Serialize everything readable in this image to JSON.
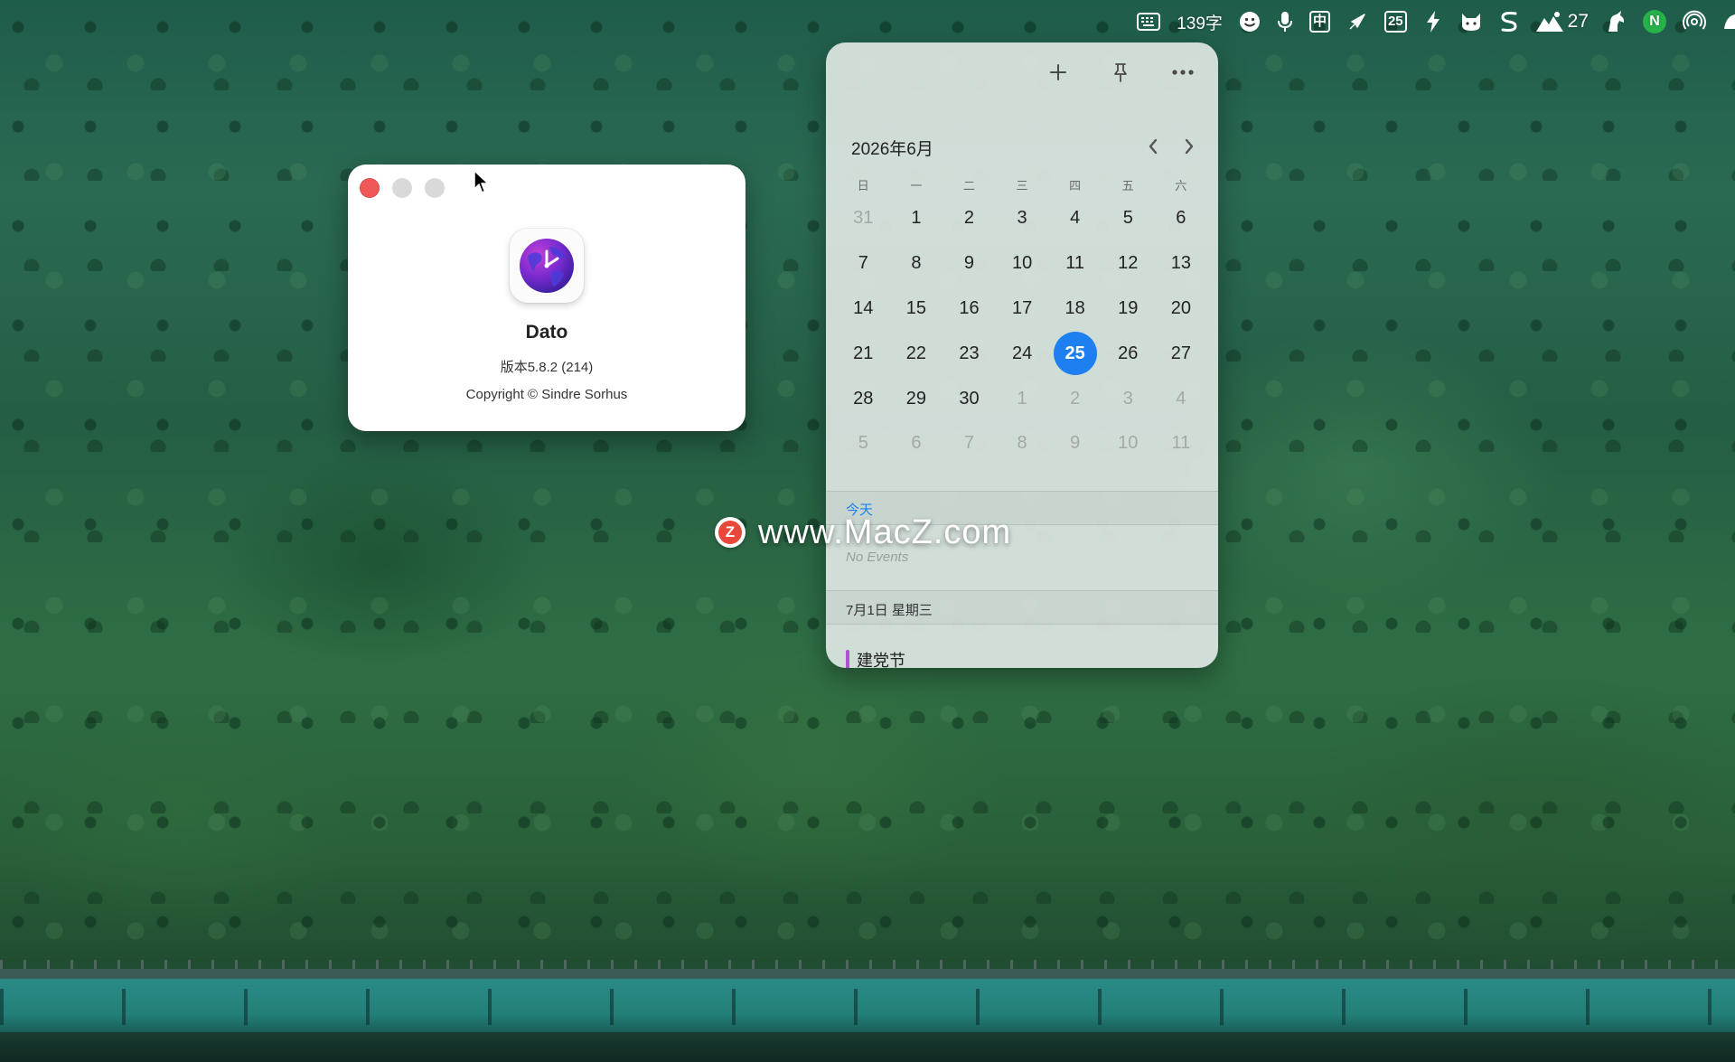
{
  "menubar": {
    "word_count": "139字",
    "ime": "中",
    "date_badge": "25",
    "weather_temp": "27",
    "notion_letter": "N",
    "icons": [
      "keyboard-icon",
      "emoji-icon",
      "microphone-icon",
      "ime-icon",
      "rocket-icon",
      "calendar-date-icon",
      "lightning-icon",
      "cat-icon",
      "scrivener-s-icon",
      "weather-icon",
      "unicorn-icon",
      "notion-icon",
      "airdrop-icon",
      "bird-icon"
    ]
  },
  "about": {
    "app_name": "Dato",
    "version": "版本5.8.2 (214)",
    "copyright": "Copyright © Sindre Sorhus"
  },
  "calendar": {
    "title": "2026年6月",
    "weekdays": [
      "日",
      "一",
      "二",
      "三",
      "四",
      "五",
      "六"
    ],
    "weeks": [
      [
        {
          "d": "31",
          "m": true
        },
        {
          "d": "1"
        },
        {
          "d": "2"
        },
        {
          "d": "3"
        },
        {
          "d": "4"
        },
        {
          "d": "5"
        },
        {
          "d": "6"
        }
      ],
      [
        {
          "d": "7"
        },
        {
          "d": "8"
        },
        {
          "d": "9"
        },
        {
          "d": "10"
        },
        {
          "d": "11"
        },
        {
          "d": "12"
        },
        {
          "d": "13"
        }
      ],
      [
        {
          "d": "14"
        },
        {
          "d": "15"
        },
        {
          "d": "16"
        },
        {
          "d": "17"
        },
        {
          "d": "18"
        },
        {
          "d": "19"
        },
        {
          "d": "20"
        }
      ],
      [
        {
          "d": "21"
        },
        {
          "d": "22"
        },
        {
          "d": "23"
        },
        {
          "d": "24"
        },
        {
          "d": "25",
          "today": true
        },
        {
          "d": "26"
        },
        {
          "d": "27"
        }
      ],
      [
        {
          "d": "28"
        },
        {
          "d": "29"
        },
        {
          "d": "30"
        },
        {
          "d": "1",
          "m": true
        },
        {
          "d": "2",
          "m": true
        },
        {
          "d": "3",
          "m": true
        },
        {
          "d": "4",
          "m": true
        }
      ],
      [
        {
          "d": "5",
          "m": true
        },
        {
          "d": "6",
          "m": true
        },
        {
          "d": "7",
          "m": true
        },
        {
          "d": "8",
          "m": true
        },
        {
          "d": "9",
          "m": true
        },
        {
          "d": "10",
          "m": true
        },
        {
          "d": "11",
          "m": true
        }
      ]
    ],
    "today_section": "今天",
    "no_events": "No Events",
    "next_section": "7月1日 星期三",
    "event": {
      "title": "建党节",
      "color": "#b44fd8"
    },
    "accent": "#1e7ff0"
  },
  "watermark": {
    "logo_letter": "Z",
    "text": "www.MacZ.com"
  }
}
